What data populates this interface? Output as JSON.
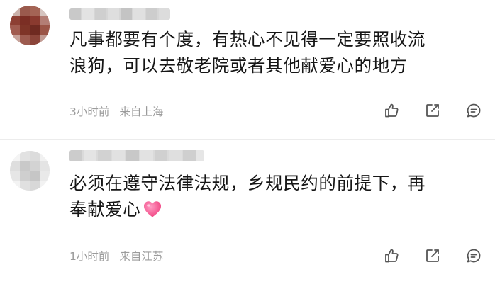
{
  "comments": [
    {
      "text_lines": [
        "凡事都要有个度，有热心不见得一定要照收流",
        "浪狗，可以去敬老院或者其他献爱心的地方"
      ],
      "time": "3小时前",
      "location": "来自上海"
    },
    {
      "text_lines": [
        "必须在遵守法律法规，乡规民约的前提下，再",
        "奉献爱心"
      ],
      "time": "1小时前",
      "location": "来自江苏"
    }
  ],
  "icons": {
    "like": "thumbs-up-icon",
    "share": "share-icon",
    "reply": "comment-icon",
    "emoji": "heart-emoji"
  },
  "colors": {
    "text": "#161616",
    "meta": "#9b9b9b",
    "icon": "#555555",
    "heart": "#f24b8a"
  }
}
